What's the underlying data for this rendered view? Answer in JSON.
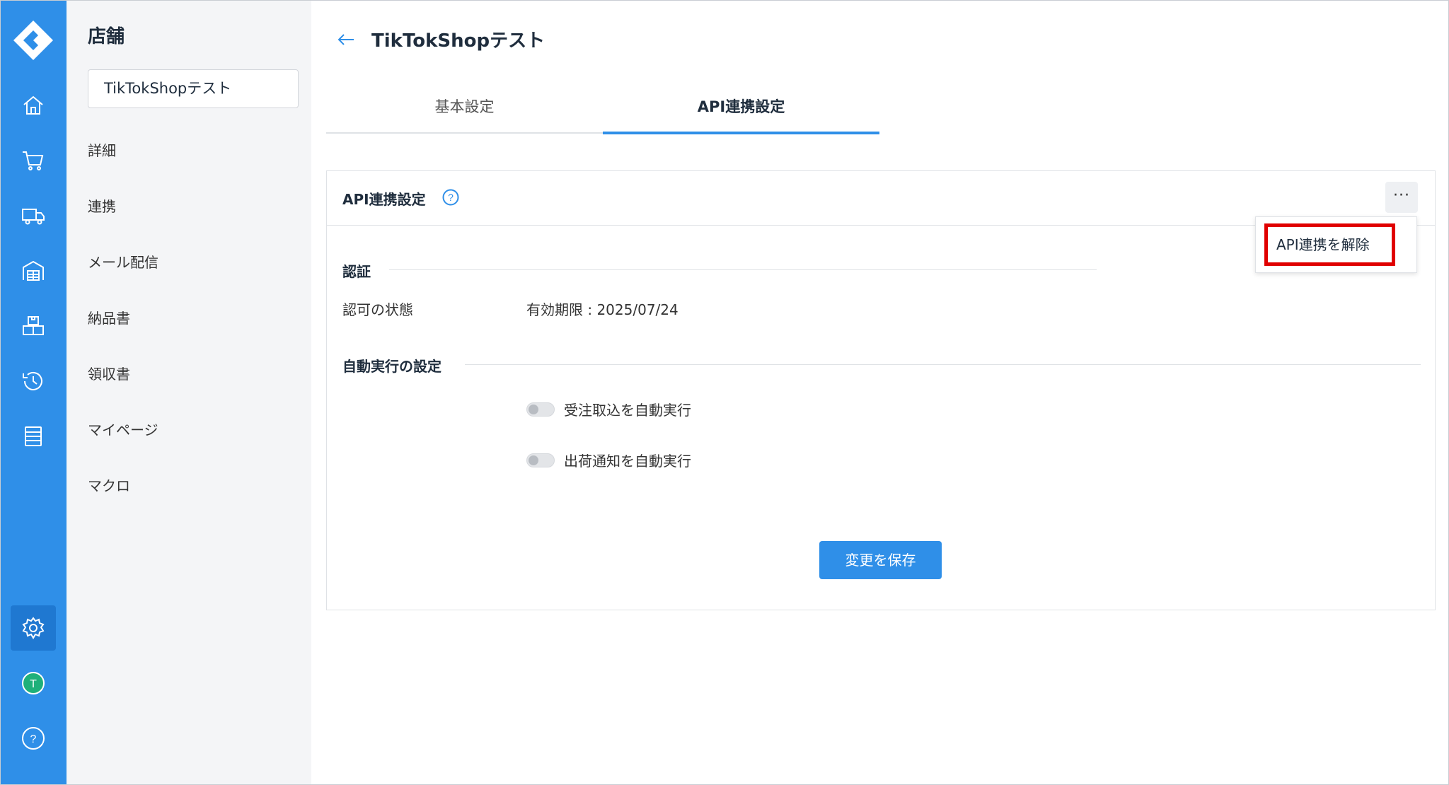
{
  "sidebar": {
    "title": "店舗",
    "store_select": "TikTokShopテスト",
    "items": [
      {
        "label": "詳細"
      },
      {
        "label": "連携"
      },
      {
        "label": "メール配信"
      },
      {
        "label": "納品書"
      },
      {
        "label": "領収書"
      },
      {
        "label": "マイページ"
      },
      {
        "label": "マクロ"
      }
    ]
  },
  "rail": {
    "icons": [
      "home-icon",
      "cart-icon",
      "truck-icon",
      "warehouse-icon",
      "boxes-icon",
      "history-icon",
      "list-icon",
      "settings-icon",
      "avatar",
      "help-icon"
    ],
    "avatar_letter": "T",
    "help_glyph": "?"
  },
  "header": {
    "title": "TikTokShopテスト"
  },
  "tabs": [
    {
      "label": "基本設定",
      "active": false
    },
    {
      "label": "API連携設定",
      "active": true
    }
  ],
  "card": {
    "title": "API連携設定",
    "help_glyph": "?",
    "more_glyph": "···"
  },
  "auth": {
    "heading": "認証",
    "label": "認可の状態",
    "value": "有効期限 : 2025/07/24"
  },
  "auto": {
    "heading": "自動実行の設定",
    "toggles": [
      {
        "label": "受注取込を自動実行",
        "on": false
      },
      {
        "label": "出荷通知を自動実行",
        "on": false
      }
    ]
  },
  "save_button": "変更を保存",
  "dropdown": {
    "item": "API連携を解除"
  },
  "colors": {
    "accent": "#2f8fe8",
    "highlight": "#e00000",
    "avatar": "#1fb07a"
  }
}
